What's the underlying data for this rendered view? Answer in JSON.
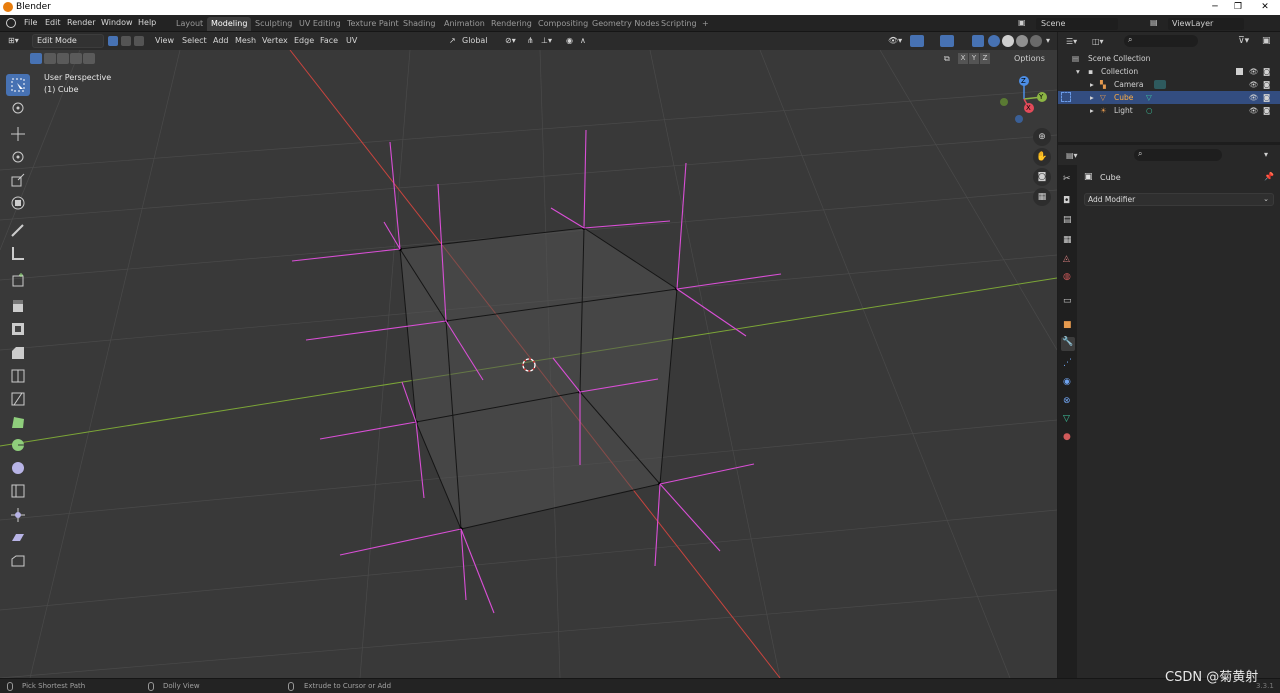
{
  "titlebar": {
    "title": "Blender"
  },
  "menu": [
    "File",
    "Edit",
    "Render",
    "Window",
    "Help"
  ],
  "workspaces": [
    {
      "label": "Layout",
      "active": false
    },
    {
      "label": "Modeling",
      "active": true
    },
    {
      "label": "Sculpting",
      "active": false
    },
    {
      "label": "UV Editing",
      "active": false
    },
    {
      "label": "Texture Paint",
      "active": false
    },
    {
      "label": "Shading",
      "active": false
    },
    {
      "label": "Animation",
      "active": false
    },
    {
      "label": "Rendering",
      "active": false
    },
    {
      "label": "Compositing",
      "active": false
    },
    {
      "label": "Geometry Nodes",
      "active": false
    },
    {
      "label": "Scripting",
      "active": false
    }
  ],
  "add_workspace": "+",
  "scene": {
    "label": "Scene",
    "viewlayer": "ViewLayer"
  },
  "header": {
    "mode": "Edit Mode",
    "menus": [
      "View",
      "Select",
      "Add",
      "Mesh",
      "Vertex",
      "Edge",
      "Face",
      "UV"
    ],
    "transform_orientation": "Global",
    "options": "Options",
    "axes": [
      "X",
      "Y",
      "Z"
    ]
  },
  "viewport": {
    "info_line1": "User Perspective",
    "info_line2": "(1) Cube",
    "gizmo": {
      "x": "X",
      "y": "Y",
      "z": "Z"
    }
  },
  "outliner": {
    "root": "Scene Collection",
    "collection": "Collection",
    "items": [
      {
        "label": "Camera",
        "selected": false
      },
      {
        "label": "Cube",
        "selected": true
      },
      {
        "label": "Light",
        "selected": false
      }
    ]
  },
  "properties": {
    "object_name": "Cube",
    "add_modifier": "Add Modifier"
  },
  "statusbar": {
    "left": "Pick Shortest Path",
    "middle": "Dolly View",
    "right": "Extrude to Cursor or Add",
    "version": "3.3.1",
    "watermark": "CSDN @菊黄射"
  },
  "colors": {
    "accent": "#4772b3",
    "selected_row": "#334d80",
    "x_axis": "#c8443e",
    "y_axis": "#7ca637",
    "normals": "#d94fd6"
  }
}
